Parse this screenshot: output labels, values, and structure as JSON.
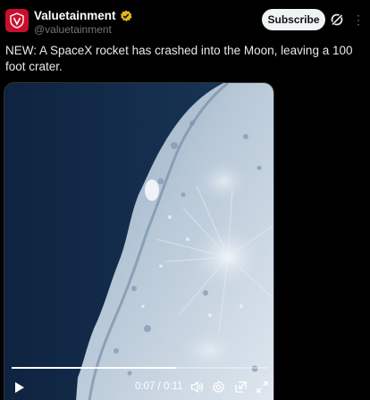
{
  "post": {
    "account_name": "Valuetainment",
    "handle": "@valuetainment",
    "subscribe_label": "Subscribe",
    "text": "NEW: A SpaceX rocket has crashed into the Moon, leaving a 100 foot crater."
  },
  "video": {
    "current_time": "0:07",
    "separator": " / ",
    "duration": "0:11",
    "progress": 0.64
  },
  "icons": {
    "avatar": "valuetainment-logo-icon",
    "verified": "verified-badge-icon",
    "grok": "grok-icon",
    "play": "play-icon",
    "volume": "volume-icon",
    "settings": "settings-gear-icon",
    "dock": "picture-in-picture-icon",
    "fullscreen": "fullscreen-icon"
  },
  "colors": {
    "brand_red": "#c8102e",
    "verified_gold": "#e2b719",
    "background": "#000000"
  }
}
